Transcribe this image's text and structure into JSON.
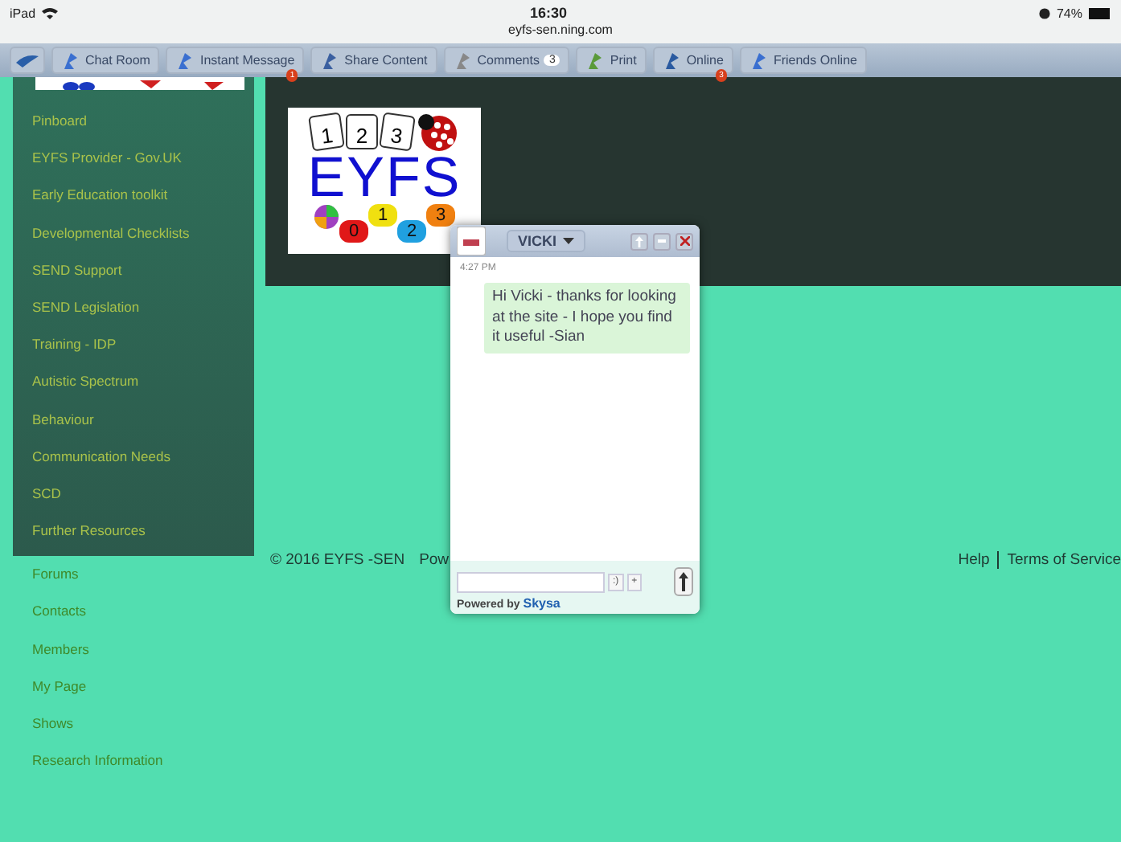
{
  "status_bar": {
    "device": "iPad",
    "time": "16:30",
    "url": "eyfs-sen.ning.com",
    "battery": "74%"
  },
  "toolbar": [
    {
      "kind": "home"
    },
    {
      "kind": "tool",
      "label": "Chat Room"
    },
    {
      "kind": "tool",
      "label": "Instant Message",
      "badge": "1"
    },
    {
      "kind": "tool",
      "label": "Share Content"
    },
    {
      "kind": "tool",
      "label": "Comments",
      "count": "3"
    },
    {
      "kind": "tool",
      "label": "Print"
    },
    {
      "kind": "tool",
      "label": "Online",
      "badge": "3"
    },
    {
      "kind": "tool",
      "label": "Friends Online"
    }
  ],
  "sidebar": {
    "panel_items": [
      "Pinboard",
      "EYFS Provider - Gov.UK",
      "Early Education toolkit",
      "Developmental Checklists",
      "SEND Support",
      "SEND Legislation",
      "Training - IDP",
      "Autistic Spectrum",
      "Behaviour",
      "Communication Needs",
      "SCD",
      "Further Resources"
    ],
    "more_items": [
      "Forums",
      "Contacts",
      "Members",
      "My Page",
      "Shows",
      "Research Information"
    ]
  },
  "logo": {
    "title": "EYFS",
    "dice": [
      "1",
      "2",
      "3"
    ],
    "caterpillar": [
      "0",
      "1",
      "2",
      "3"
    ]
  },
  "footer": {
    "copyright": "© 2016 EYFS -SEN",
    "powered": "Pow",
    "links": [
      "Help",
      "Terms of Service"
    ]
  },
  "chat": {
    "user": "VICKI",
    "time": "4:27 PM",
    "message": "Hi Vicki - thanks for looking at the site - I hope you find it useful -Sian",
    "emoji": ":)",
    "add": "+",
    "powered_by": "Powered by",
    "brand": "Skysa"
  }
}
